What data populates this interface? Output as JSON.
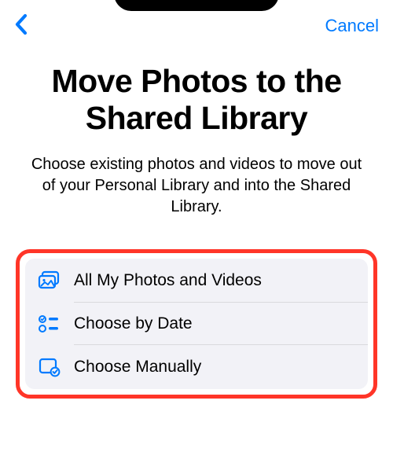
{
  "nav": {
    "cancel_label": "Cancel"
  },
  "page": {
    "title": "Move Photos to the Shared Library",
    "subtitle": "Choose existing photos and videos to move out of your Personal Library and into the Shared Library."
  },
  "options": [
    {
      "icon": "photos-stack-icon",
      "label": "All My Photos and Videos"
    },
    {
      "icon": "list-check-icon",
      "label": "Choose by Date"
    },
    {
      "icon": "rect-check-icon",
      "label": "Choose Manually"
    }
  ],
  "colors": {
    "accent": "#007aff",
    "highlight_border": "#ff3528",
    "panel_bg": "#f2f2f7"
  }
}
